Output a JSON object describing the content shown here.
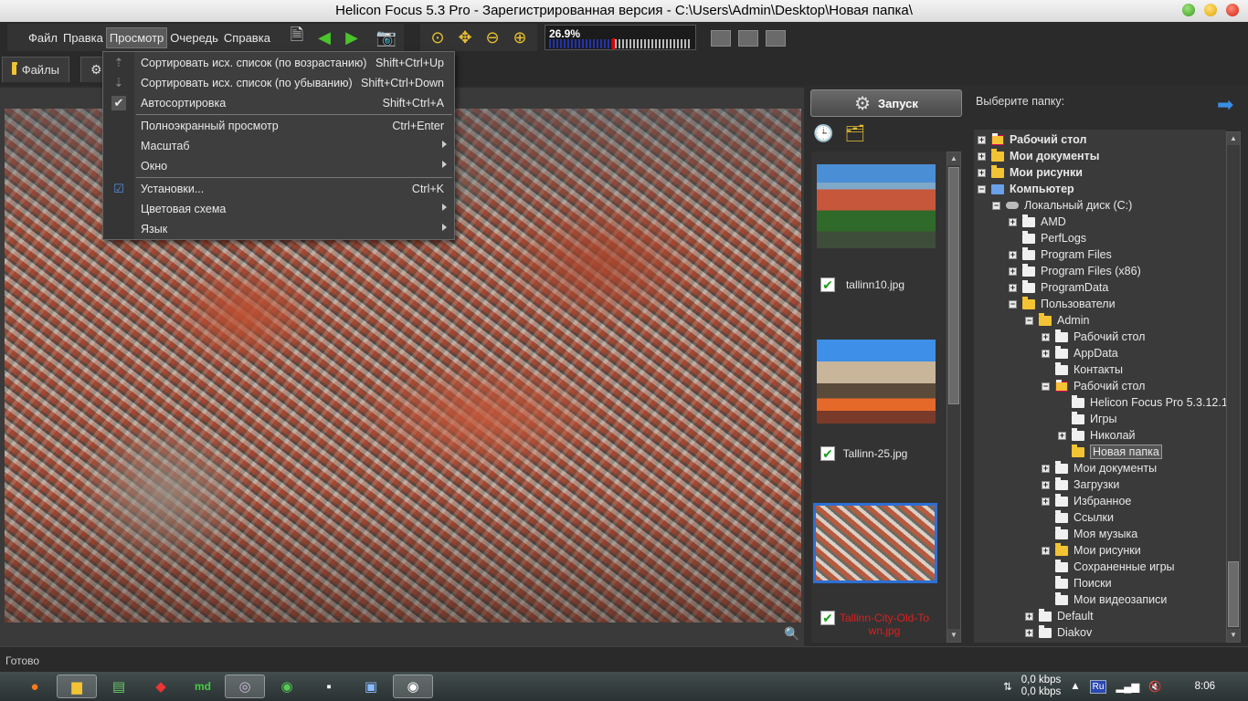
{
  "window": {
    "title": "Helicon Focus 5.3 Pro - Зарегистрированная версия - C:\\Users\\Admin\\Desktop\\Новая папка\\"
  },
  "menu": [
    "Файл",
    "Правка",
    "Просмотр",
    "Очередь",
    "Справка"
  ],
  "toolbar": {
    "zoom_value": "26.9%",
    "zoom_fraction": 0.27,
    "icons": [
      "add-files-icon",
      "back-arrow-icon",
      "forward-arrow-icon",
      "camera-icon",
      "zoom-fit-icon",
      "zoom-actual-icon",
      "zoom-out-icon",
      "zoom-in-icon"
    ]
  },
  "tabs": {
    "files": "Файлы"
  },
  "dropdown": {
    "items": [
      {
        "label": "Сортировать исх. список (по возрастанию)",
        "shortcut": "Shift+Ctrl+Up"
      },
      {
        "label": "Сортировать исх. список (по убыванию)",
        "shortcut": "Shift+Ctrl+Down"
      },
      {
        "label": "Автосортировка",
        "shortcut": "Shift+Ctrl+A"
      },
      {
        "label": "Полноэкранный просмотр",
        "shortcut": "Ctrl+Enter"
      },
      {
        "label": "Масштаб",
        "shortcut": ""
      },
      {
        "label": "Окно",
        "shortcut": ""
      },
      {
        "label": "Установки...",
        "shortcut": "Ctrl+K"
      },
      {
        "label": "Цветовая схема",
        "shortcut": ""
      },
      {
        "label": "Язык",
        "shortcut": ""
      }
    ]
  },
  "launch": {
    "label": "Запуск"
  },
  "thumbnails": [
    {
      "name": "tallinn10.jpg",
      "checked": true
    },
    {
      "name": "Tallinn-25.jpg",
      "checked": true
    },
    {
      "name": "Tallinn-City-Old-To wn.jpg",
      "checked": true,
      "selected": true
    }
  ],
  "folders": {
    "header": "Выберите папку:",
    "tree": [
      "Рабочий стол",
      "Мои документы",
      "Мои рисунки",
      "Компьютер",
      "Локальный диск (C:)",
      "AMD",
      "PerfLogs",
      "Program Files",
      "Program Files (x86)",
      "ProgramData",
      "Пользователи",
      "Admin",
      "Рабочий стол",
      "AppData",
      "Контакты",
      "Рабочий стол",
      "Helicon Focus Pro 5.3.12.1",
      "Игры",
      "Николай",
      "Новая папка",
      "Мои документы",
      "Загрузки",
      "Избранное",
      "Ссылки",
      "Моя музыка",
      "Мои рисунки",
      "Сохраненные игры",
      "Поиски",
      "Мои видеозаписи",
      "Default",
      "Diakov"
    ]
  },
  "status": {
    "text": "Готово"
  },
  "taskbar": {
    "net_down": "0,0 kbps",
    "net_up": "0,0 kbps",
    "lang": "Ru",
    "clock": "8:06"
  }
}
